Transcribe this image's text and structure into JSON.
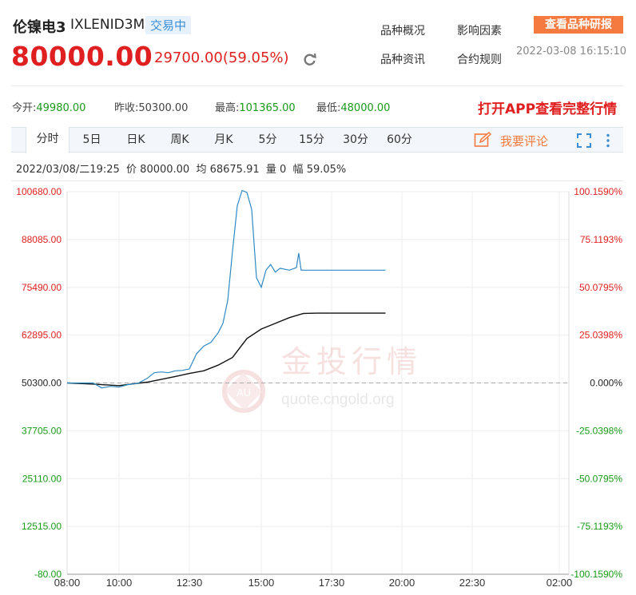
{
  "header": {
    "name": "伦镍电3",
    "code": "IXLENID3M",
    "status": "交易中",
    "price": "80000.00",
    "change": "29700.00(59.05%)",
    "links": [
      "品种概况",
      "影响因素",
      "品种资讯",
      "合约规则"
    ],
    "research_button": "查看品种研报",
    "timestamp": "2022-03-08 16:15:10"
  },
  "stats": {
    "open_label": "今开:",
    "open": "49980.00",
    "prev_label": "昨收:",
    "prev": "50300.00",
    "high_label": "最高:",
    "high": "101365.00",
    "low_label": "最低:",
    "low": "48000.00",
    "open_app": "打开APP查看完整行情"
  },
  "tabs": [
    "分时",
    "5日",
    "日K",
    "周K",
    "月K",
    "5分",
    "15分",
    "30分",
    "60分"
  ],
  "comment_label": "我要评论",
  "info_line": "2022/03/08/二19:25  价 80000.00  均 68675.91  量 0  幅 59.05%",
  "watermark": {
    "text": "金投行情",
    "url": "quote.cngold.org",
    "logo": "AU"
  },
  "chart_data": {
    "type": "line",
    "x_ticks": [
      "08:00",
      "10:00",
      "12:30",
      "15:00",
      "17:30",
      "20:00",
      "22:30",
      "02:00"
    ],
    "y_left": [
      "100680.00",
      "88085.00",
      "75490.00",
      "62895.00",
      "50300.00",
      "37705.00",
      "25110.00",
      "12515.00",
      "-80.00"
    ],
    "y_right": [
      "100.1590%",
      "75.1193%",
      "50.0795%",
      "25.0398%",
      "0.000%",
      "-25.0398%",
      "-50.0795%",
      "-75.1193%",
      "-100.1590%"
    ],
    "ylim": [
      -80,
      100680
    ],
    "baseline": 50300,
    "colors": {
      "price": "#2f8ac4",
      "avg": "#111111",
      "up": "#e02020",
      "down": "#1a9a1a"
    },
    "series": [
      {
        "name": "价",
        "values": [
          [
            "08:00",
            50300
          ],
          [
            "09:00",
            50300
          ],
          [
            "09:20",
            49000
          ],
          [
            "09:40",
            49400
          ],
          [
            "10:00",
            49200
          ],
          [
            "10:20",
            49900
          ],
          [
            "10:40",
            50200
          ],
          [
            "11:00",
            51500
          ],
          [
            "11:15",
            53000
          ],
          [
            "11:30",
            53200
          ],
          [
            "11:45",
            53000
          ],
          [
            "12:00",
            53500
          ],
          [
            "12:15",
            53600
          ],
          [
            "12:30",
            54000
          ],
          [
            "12:45",
            58000
          ],
          [
            "13:00",
            60000
          ],
          [
            "13:15",
            61000
          ],
          [
            "13:30",
            63500
          ],
          [
            "13:40",
            66000
          ],
          [
            "13:50",
            72000
          ],
          [
            "14:00",
            85000
          ],
          [
            "14:10",
            97000
          ],
          [
            "14:20",
            101000
          ],
          [
            "14:30",
            100500
          ],
          [
            "14:40",
            96000
          ],
          [
            "14:50",
            78000
          ],
          [
            "15:00",
            75500
          ],
          [
            "15:10",
            80000
          ],
          [
            "15:20",
            81500
          ],
          [
            "15:30",
            79500
          ],
          [
            "15:40",
            80500
          ],
          [
            "16:00",
            80000
          ],
          [
            "16:15",
            80700
          ],
          [
            "16:20",
            84500
          ],
          [
            "16:25",
            80000
          ],
          [
            "17:00",
            80000
          ],
          [
            "18:00",
            80000
          ],
          [
            "19:25",
            80000
          ]
        ]
      },
      {
        "name": "均",
        "values": [
          [
            "08:00",
            50300
          ],
          [
            "09:00",
            50000
          ],
          [
            "10:00",
            49600
          ],
          [
            "11:00",
            50500
          ],
          [
            "12:00",
            52000
          ],
          [
            "12:30",
            52800
          ],
          [
            "13:00",
            53500
          ],
          [
            "13:30",
            55000
          ],
          [
            "14:00",
            57000
          ],
          [
            "14:30",
            62000
          ],
          [
            "15:00",
            64500
          ],
          [
            "15:30",
            66000
          ],
          [
            "16:00",
            67500
          ],
          [
            "16:30",
            68600
          ],
          [
            "17:00",
            68676
          ],
          [
            "18:00",
            68676
          ],
          [
            "19:25",
            68676
          ]
        ]
      }
    ]
  }
}
